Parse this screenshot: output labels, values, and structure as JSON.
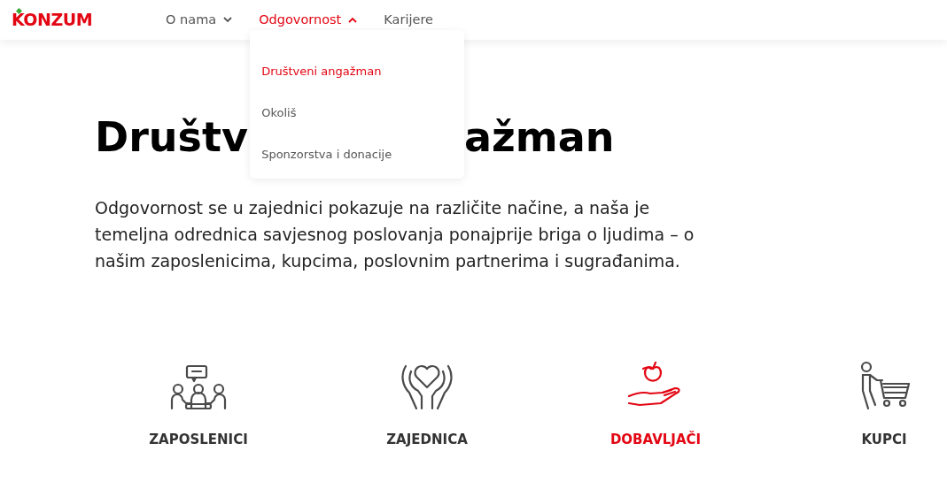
{
  "logo": "KONZUM",
  "nav": [
    {
      "label": "O nama",
      "selected": false,
      "expanded": false
    },
    {
      "label": "Odgovornost",
      "selected": true,
      "expanded": true
    },
    {
      "label": "Karijere",
      "selected": false
    }
  ],
  "dropdown": [
    {
      "label": "Društveni angažman",
      "selected": true
    },
    {
      "label": "Okoliš",
      "selected": false
    },
    {
      "label": "Sponzorstva i donacije",
      "selected": false
    }
  ],
  "heading": [
    "Društv",
    "ažman"
  ],
  "intro": "Odgovornost se u zajednici pokazuje na različite načine, a naša je temeljna odrednica savjesnog poslovanja ponajprije briga o ljudima – o našim zaposlenicima, kupcima, poslovnim partnerima i sugrađanima.",
  "categories": [
    {
      "kind": "employees",
      "label": "ZAPOSLENICI",
      "selected": false
    },
    {
      "kind": "community",
      "label": "ZAJEDNICA",
      "selected": false
    },
    {
      "kind": "suppliers",
      "label": "DOBAVLJAČI",
      "selected": true
    },
    {
      "kind": "customers",
      "label": "KUPCI",
      "selected": false
    }
  ]
}
